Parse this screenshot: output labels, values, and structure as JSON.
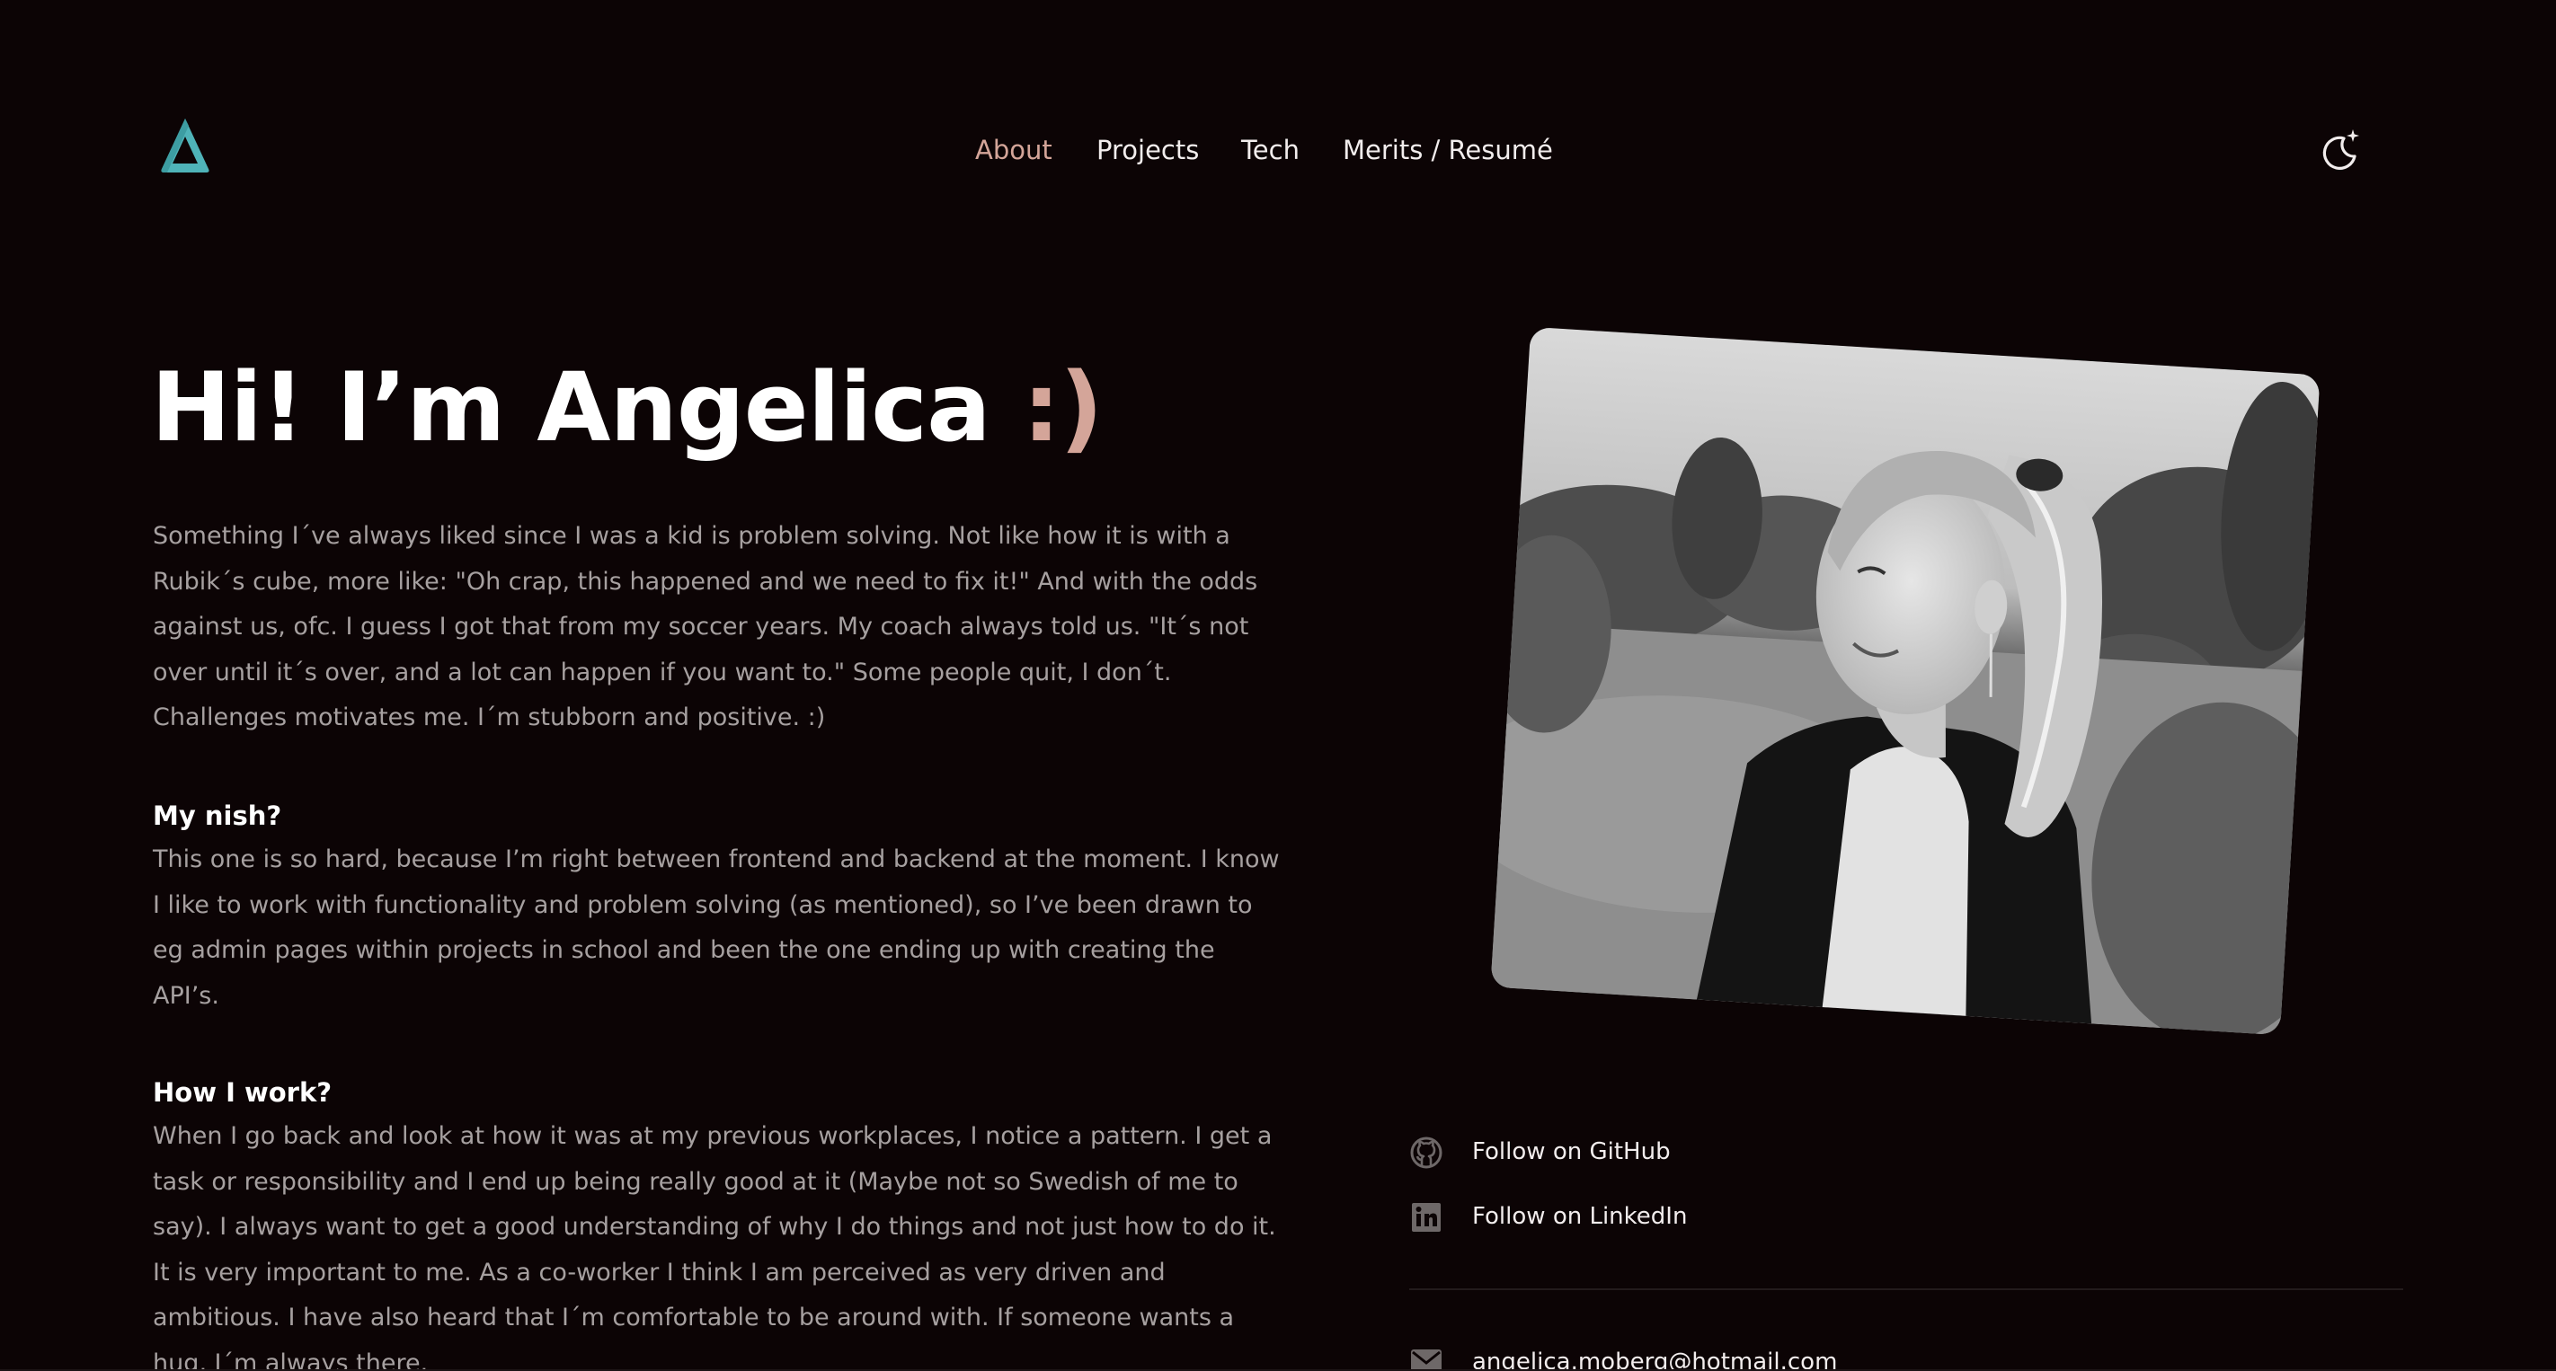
{
  "header": {
    "logo_icon": "triangle-logo-icon",
    "nav": [
      {
        "label": "About",
        "active": true
      },
      {
        "label": "Projects",
        "active": false
      },
      {
        "label": "Tech",
        "active": false
      },
      {
        "label": "Merits / Resumé",
        "active": false
      }
    ],
    "theme_toggle_icon": "moon-star-icon"
  },
  "hero": {
    "title": "Hi! I’m Angelica",
    "smiley": ":)"
  },
  "about": {
    "intro": "Something I´ve always liked since I was a kid is problem solving. Not like how it is with a Rubik´s cube, more like: \"Oh crap, this happened and we need to fix it!\" And with the odds against us, ofc. I guess I got that from my soccer years. My coach always told us. \"It´s not over until it´s over, and a lot can happen if you want to.\" Some people quit, I don´t. Challenges motivates me. I´m stubborn and positive. :)",
    "niche_heading": "My nish?",
    "niche_text": "This one is so hard, because I’m right between frontend and backend at the moment. I know I like to work with functionality and problem solving (as mentioned), so I’ve been drawn to eg admin pages within projects in school and been the one ending up with creating the API’s.",
    "work_heading": "How I work?",
    "work_text": "When I go back and look at how it was at my previous workplaces, I notice a pattern. I get a task or responsibility and I end up being really good at it (Maybe not so Swedish of me to say). I always want to get a good understanding of why I do things and not just how to do it. It is very important to me. As a co-worker I think I am perceived as very driven and ambitious. I have also heard that I´m comfortable to be around with. If someone wants a hug, I´m always there."
  },
  "links": {
    "github": {
      "label": "Follow on GitHub",
      "icon": "github-icon"
    },
    "linkedin": {
      "label": "Follow on LinkedIn",
      "icon": "linkedin-icon"
    },
    "email": {
      "label": "angelica.moberg@hotmail.com",
      "icon": "mail-icon"
    }
  },
  "colors": {
    "background": "#0c0405",
    "accent": "#d4a599",
    "logo": "#4fb3b8",
    "body_text": "#a6a0a0",
    "heading_text": "#ffffff"
  }
}
